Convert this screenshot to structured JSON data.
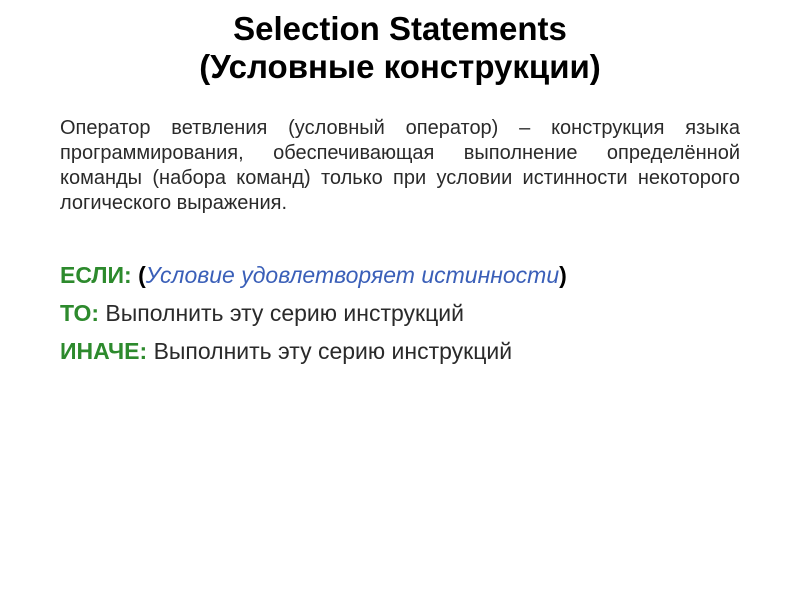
{
  "title": {
    "line1": "Selection Statements",
    "line2_open": "(",
    "line2_text": "Условные конструкции",
    "line2_close": ")"
  },
  "paragraph": "Оператор ветвления (условный оператор) – конструкция языка программирования, обеспечивающая выполнение определённой команды (набора команд) только при условии истинности некоторого логического выражения.",
  "if_stmt": {
    "keyword": "ЕСЛИ:",
    "paren_open": "(",
    "condition": "Условие удовлетворяет истинности",
    "paren_close": ")"
  },
  "then_stmt": {
    "keyword": "ТО:",
    "action": "Выполнить эту серию инструкций"
  },
  "else_stmt": {
    "keyword": "ИНАЧЕ:",
    "action": "Выполнить эту серию инструкций"
  }
}
